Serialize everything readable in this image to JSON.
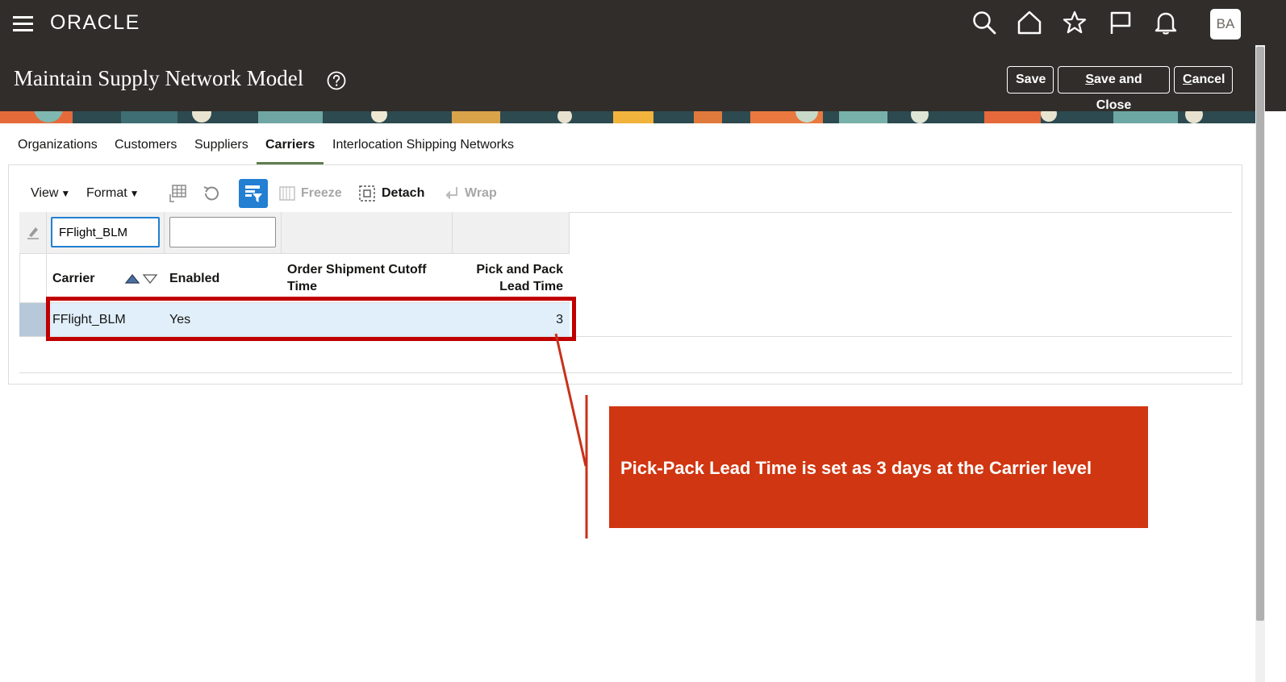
{
  "header": {
    "brand": "ORACLE",
    "avatar_initials": "BA",
    "page_title": "Maintain Supply Network Model",
    "buttons": {
      "save": "Save",
      "save_and_close_first": "S",
      "save_and_close_rest": "ave and Close",
      "cancel_first": "C",
      "cancel_rest": "ancel"
    }
  },
  "tabs": [
    {
      "label": "Organizations"
    },
    {
      "label": "Customers"
    },
    {
      "label": "Suppliers"
    },
    {
      "label": "Carriers",
      "active": true
    },
    {
      "label": "Interlocation Shipping Networks"
    }
  ],
  "toolbar": {
    "view": "View",
    "format": "Format",
    "freeze": "Freeze",
    "detach": "Detach",
    "wrap": "Wrap"
  },
  "filters": {
    "carrier_value": "FFlight_BLM",
    "enabled_value": ""
  },
  "table": {
    "columns": {
      "carrier": "Carrier",
      "enabled": "Enabled",
      "cutoff_line1": "Order Shipment Cutoff",
      "cutoff_line2": "Time",
      "pick_line1": "Pick and Pack",
      "pick_line2": "Lead Time"
    },
    "rows": [
      {
        "carrier": "FFlight_BLM",
        "enabled": "Yes",
        "cutoff": "",
        "pick_pack_lead_time": "3"
      }
    ]
  },
  "callout": {
    "text": "Pick-Pack Lead Time is set as 3 days at the Carrier level"
  },
  "colors": {
    "header_bg": "#312d2a",
    "accent_blue": "#227fd2",
    "callout_bg": "#d03611",
    "highlight_border": "#c00000",
    "tab_underline": "#5f7d4f"
  }
}
